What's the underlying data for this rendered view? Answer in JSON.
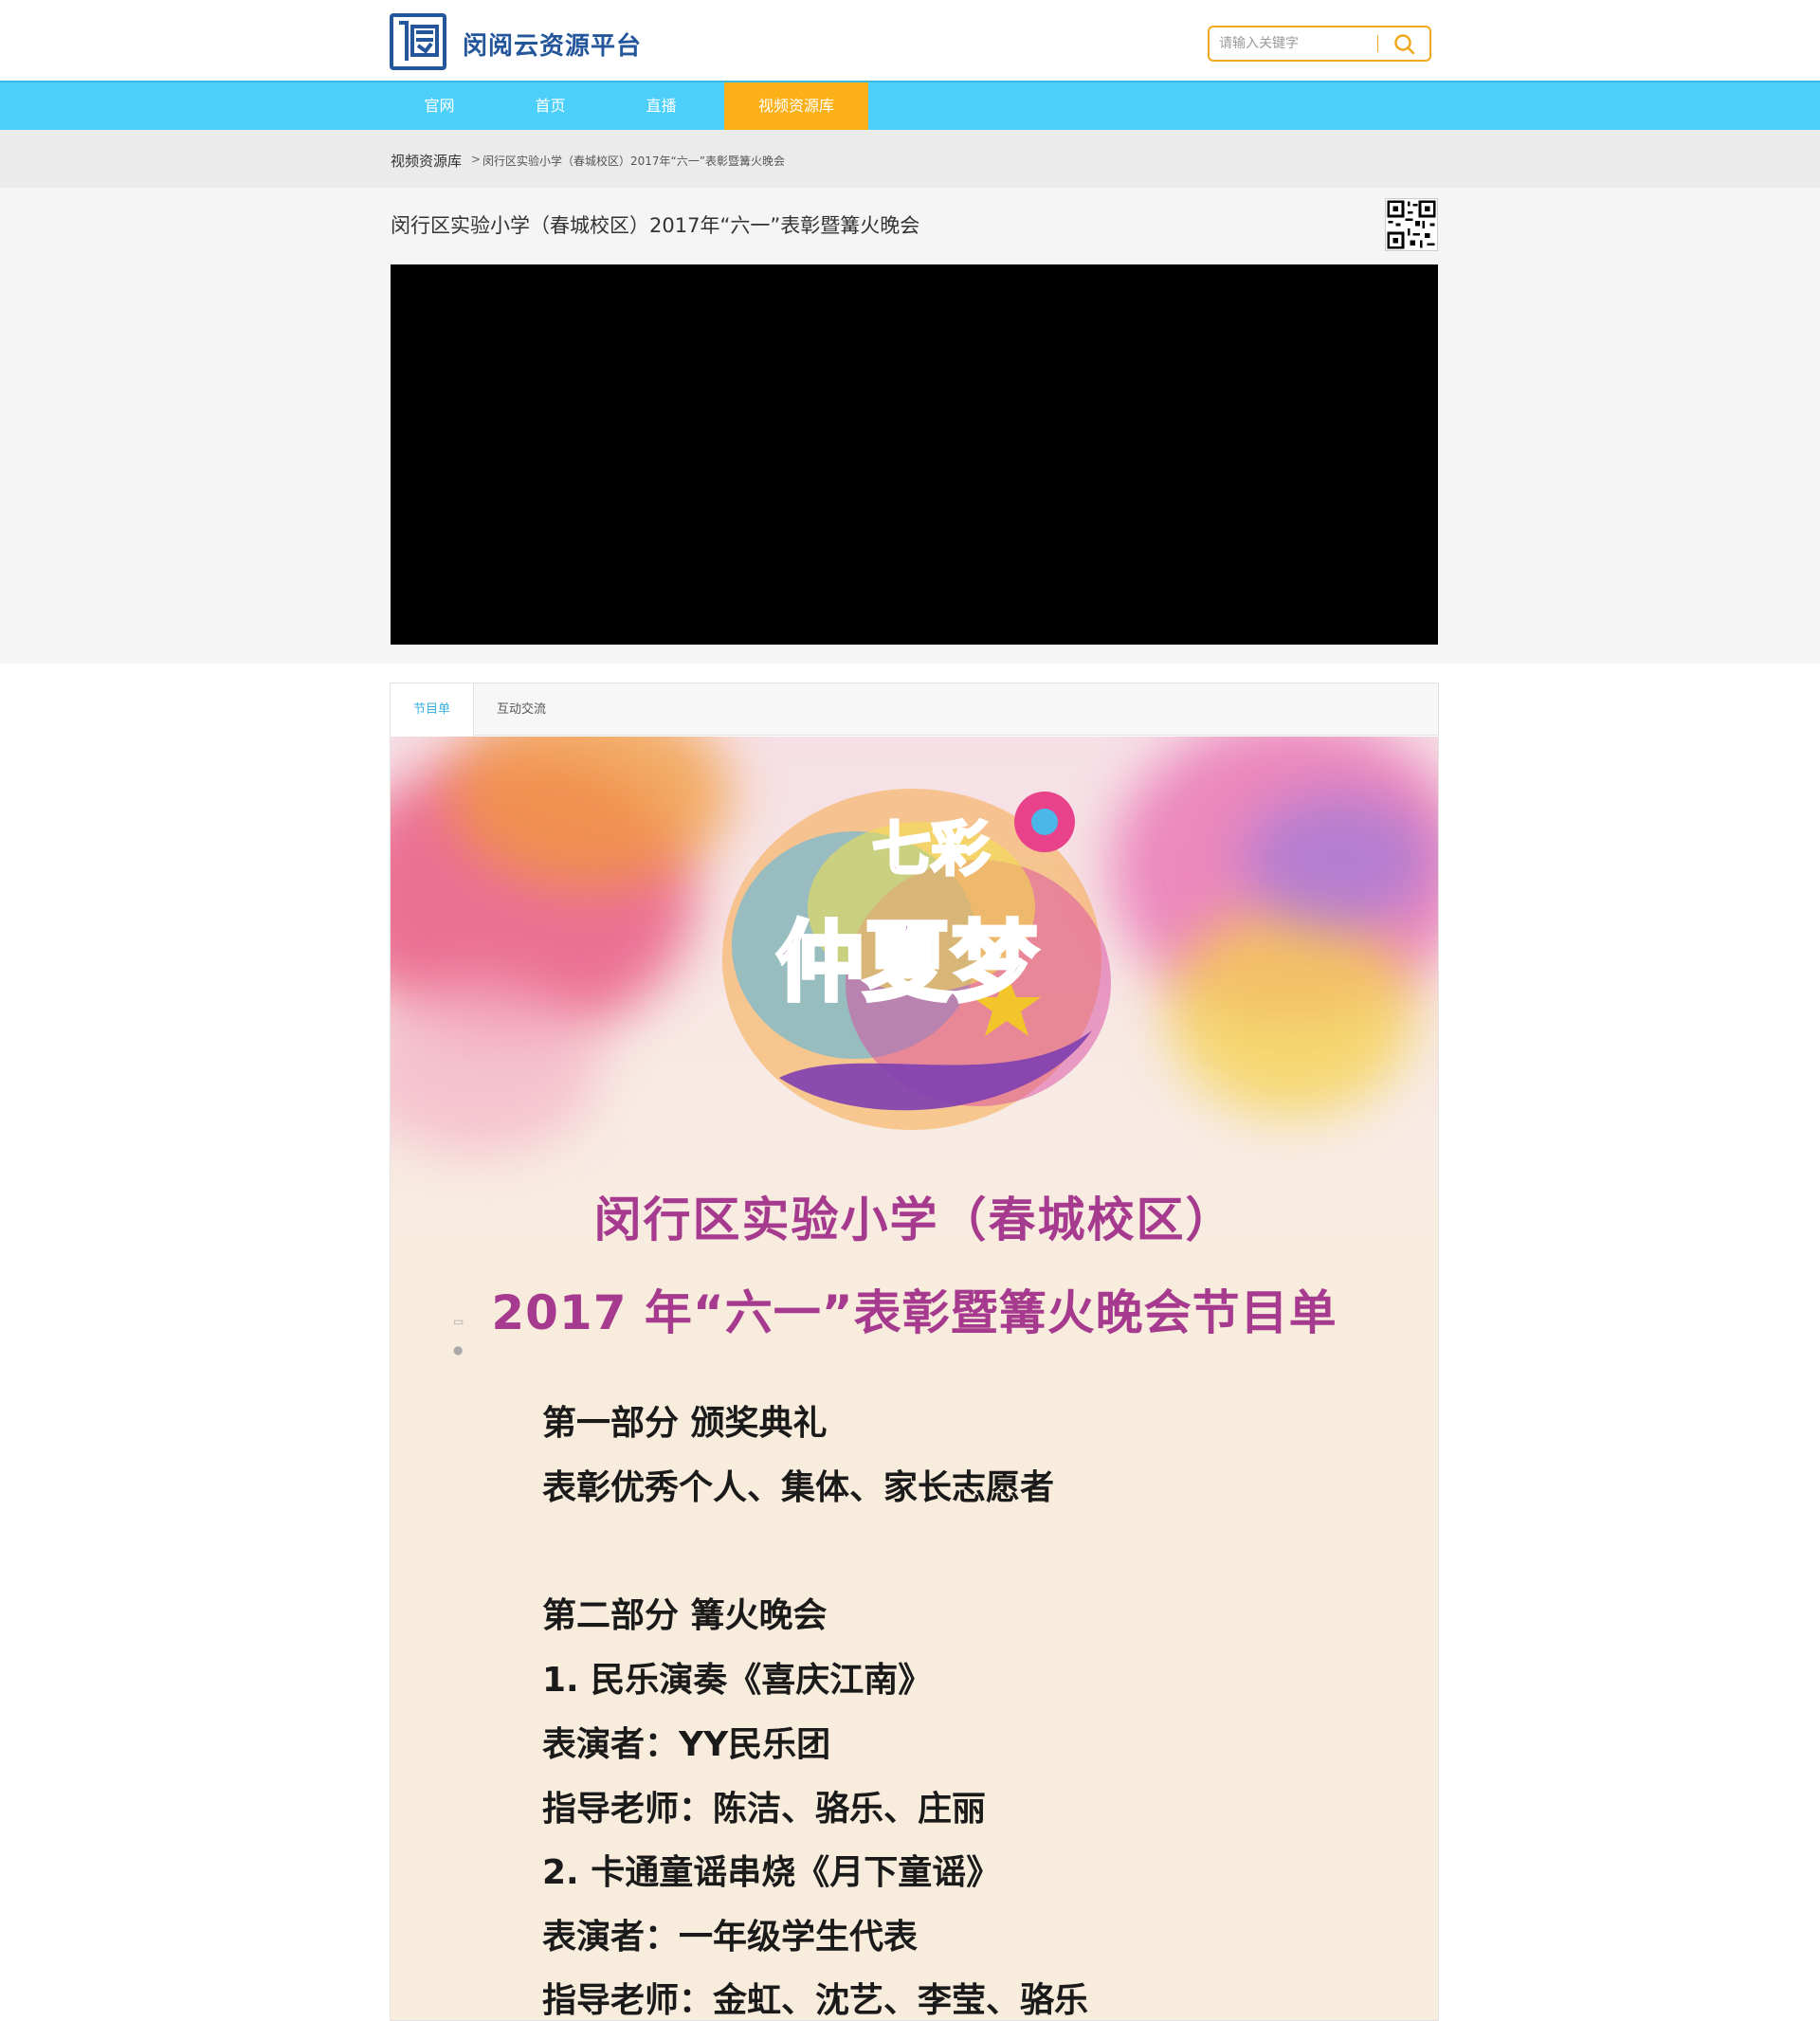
{
  "header": {
    "brand": "闵阅云资源平台",
    "search_placeholder": "请输入关键字"
  },
  "nav": {
    "items": [
      {
        "label": "官网"
      },
      {
        "label": "首页"
      },
      {
        "label": "直播"
      },
      {
        "label": "视频资源库",
        "active": true
      }
    ]
  },
  "breadcrumb": {
    "root": "视频资源库",
    "separator": ">",
    "current": "闵行区实验小学（春城校区）2017年“六一”表彰暨篝火晚会"
  },
  "video": {
    "title": "闵行区实验小学（春城校区）2017年“六一”表彰暨篝火晚会"
  },
  "tabs": [
    {
      "label": "节目单",
      "active": true
    },
    {
      "label": "互动交流",
      "active": false
    }
  ],
  "poster": {
    "logo_top": "七彩",
    "logo_main": "仲夏梦",
    "heading1": "闵行区实验小学（春城校区）",
    "heading2": "2017 年“六一”表彰暨篝火晚会节目单",
    "lines": [
      "第一部分 颁奖典礼",
      "表彰优秀个人、集体、家长志愿者",
      "第二部分 篝火晚会",
      "1. 民乐演奏《喜庆江南》",
      "表演者：YY民乐团",
      "指导老师：陈洁、骆乐、庄丽",
      "2. 卡通童谣串烧《月下童谣》",
      "表演者：一年级学生代表",
      "指导老师：金虹、沈艺、李莹、骆乐"
    ]
  },
  "colors": {
    "brand_blue": "#23569a",
    "nav_bg": "#4ccffb",
    "nav_active": "#fbb017",
    "search_border": "#f2a81d",
    "poster_heading": "#a53a8e"
  }
}
